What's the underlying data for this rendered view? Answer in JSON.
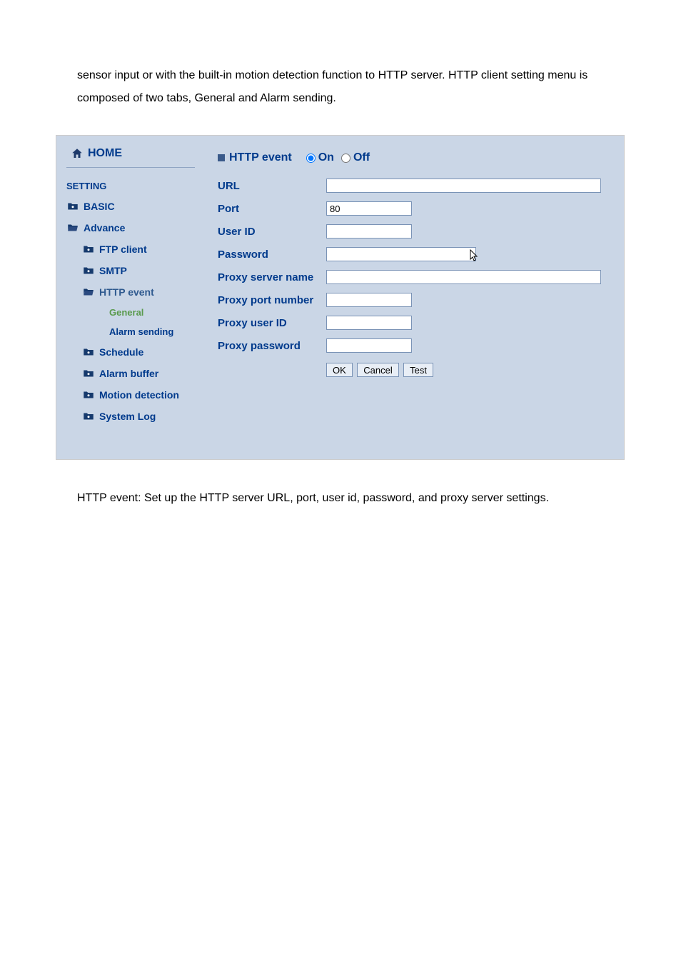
{
  "intro_text": "sensor input or with the built-in motion detection function to HTTP server. HTTP client setting menu is composed of two tabs, General and Alarm sending.",
  "home_label": "HOME",
  "section_label": "SETTING",
  "nav": {
    "basic": "BASIC",
    "advance": "Advance",
    "ftp": "FTP client",
    "smtp": "SMTP",
    "http": "HTTP event",
    "general": "General",
    "alarm": "Alarm sending",
    "schedule": "Schedule",
    "alarm_buffer": "Alarm buffer",
    "motion": "Motion detection",
    "syslog": "System Log"
  },
  "form": {
    "title": "HTTP event",
    "on": "On",
    "off": "Off",
    "url_label": "URL",
    "url_val": "",
    "port_label": "Port",
    "port_val": "80",
    "user_label": "User ID",
    "user_val": "",
    "pass_label": "Password",
    "pass_val": "",
    "proxy_server_label": "Proxy server name",
    "proxy_server_val": "",
    "proxy_port_label": "Proxy port number",
    "proxy_port_val": "",
    "proxy_user_label": "Proxy user ID",
    "proxy_user_val": "",
    "proxy_pass_label": "Proxy password",
    "proxy_pass_val": ""
  },
  "buttons": {
    "ok": "OK",
    "cancel": "Cancel",
    "test": "Test"
  },
  "outro_text": "HTTP event: Set up the HTTP server URL, port, user id, password, and proxy server settings."
}
